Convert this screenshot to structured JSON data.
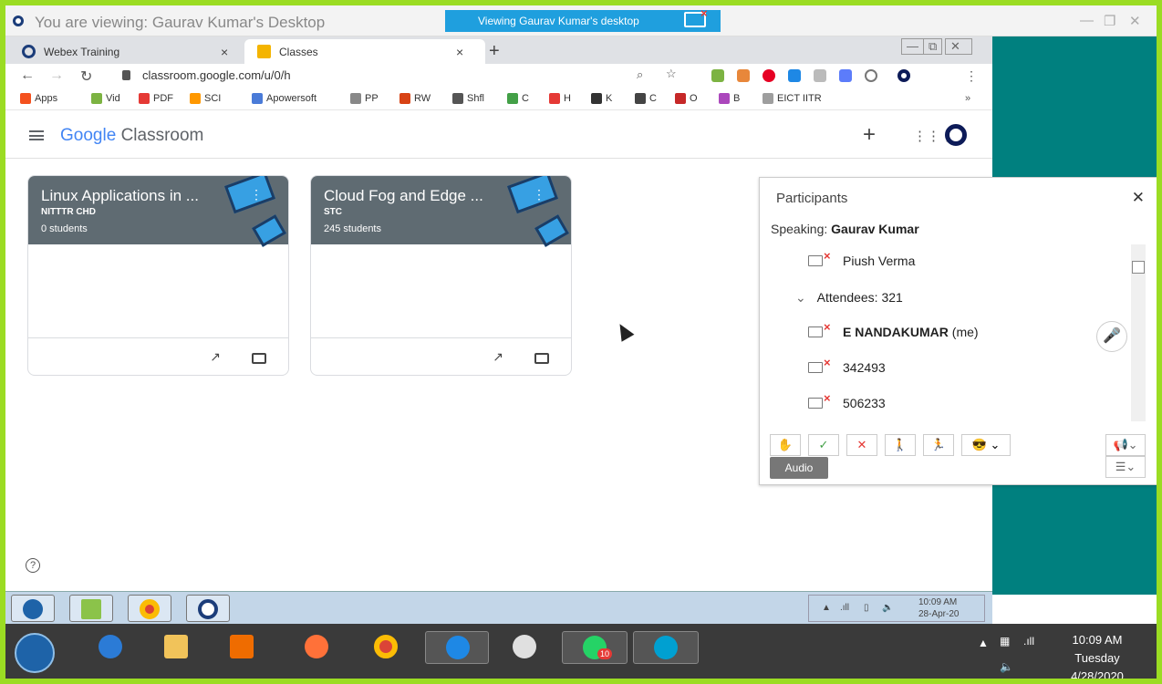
{
  "window": {
    "title": "You are viewing: Gaurav Kumar's Desktop",
    "viewing_badge": "Viewing Gaurav Kumar's desktop"
  },
  "tabs": [
    {
      "label": "Webex Training",
      "close": "×"
    },
    {
      "label": "Classes",
      "close": "×"
    }
  ],
  "new_tab": "+",
  "address": {
    "url": "classroom.google.com/u/0/h"
  },
  "bookmarks": [
    {
      "label": "Apps",
      "color": "#f4511e"
    },
    {
      "label": "Vid",
      "color": "#7cb342"
    },
    {
      "label": "PDF",
      "color": "#e53935"
    },
    {
      "label": "SCI",
      "color": "#ff9800"
    },
    {
      "label": "Apowersoft",
      "color": "#4a7bd8"
    },
    {
      "label": "PP",
      "color": "#888"
    },
    {
      "label": "RW",
      "color": "#d84315"
    },
    {
      "label": "Shfl",
      "color": "#555"
    },
    {
      "label": "C",
      "color": "#43a047"
    },
    {
      "label": "H",
      "color": "#e53935"
    },
    {
      "label": "K",
      "color": "#333"
    },
    {
      "label": "C",
      "color": "#444"
    },
    {
      "label": "O",
      "color": "#c62828"
    },
    {
      "label": "B",
      "color": "#ab47bc"
    },
    {
      "label": "EICT IITR",
      "color": "#9e9e9e"
    }
  ],
  "bookmarks_more": "»",
  "classroom": {
    "brand": "Google",
    "product": "Classroom"
  },
  "cards": [
    {
      "title": "Linux Applications in ...",
      "section": "NITTTR CHD",
      "students": "0 students"
    },
    {
      "title": "Cloud Fog and Edge ...",
      "section": "STC",
      "students": "245 students"
    }
  ],
  "participants": {
    "header": "Participants",
    "speaking_label": "Speaking:",
    "speaking_name": "Gaurav Kumar",
    "host": "Piush Verma",
    "attendees_label": "Attendees: 321",
    "me_name": "E NANDAKUMAR",
    "me_suffix": "(me)",
    "list": [
      "342493",
      "506233"
    ],
    "audio_button": "Audio"
  },
  "taskbar_inner": {
    "time": "10:09 AM",
    "date": "28-Apr-20"
  },
  "taskbar_outer": {
    "time": "10:09 AM",
    "day": "Tuesday",
    "date": "4/28/2020",
    "whatsapp_badge": "10"
  }
}
